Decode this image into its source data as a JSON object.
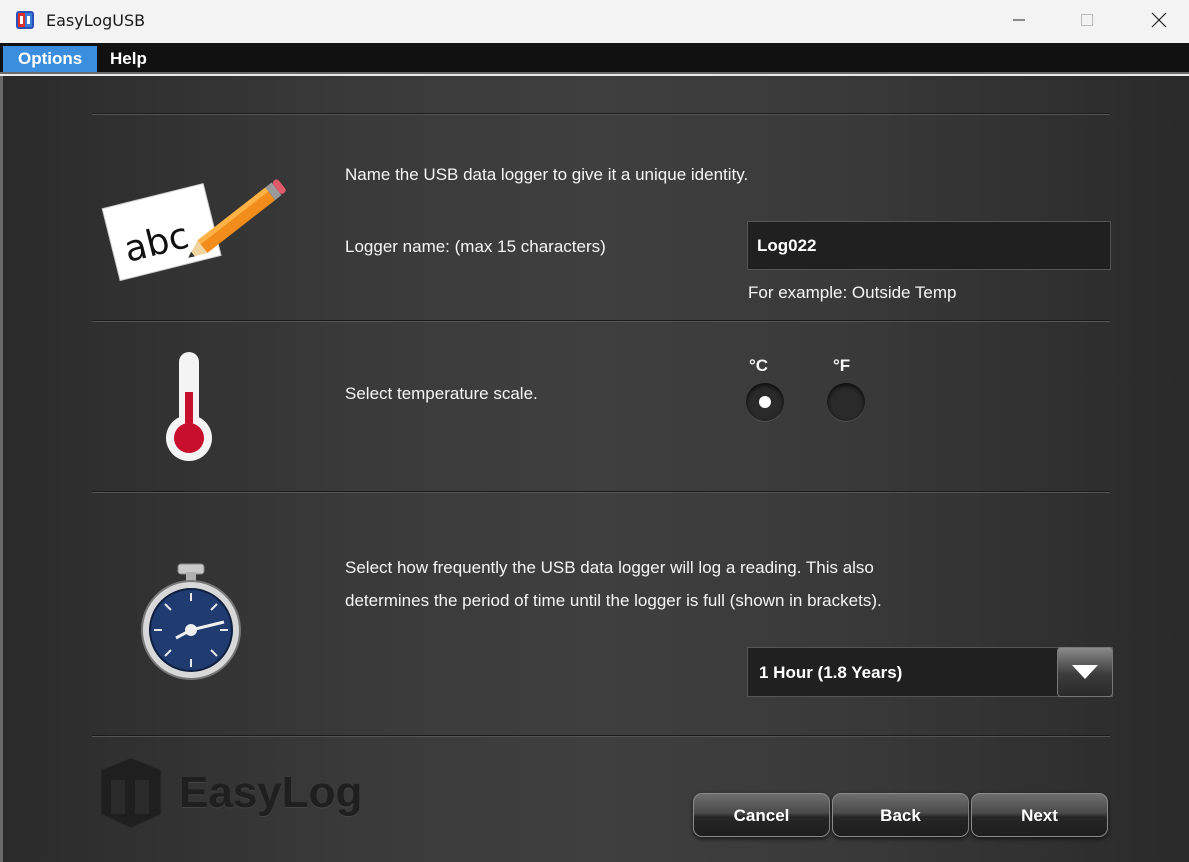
{
  "window": {
    "title": "EasyLogUSB"
  },
  "menu": {
    "items": [
      "Options",
      "Help"
    ]
  },
  "name_section": {
    "instruction": "Name the USB data logger to give it a unique identity.",
    "label": "Logger name: (max 15 characters)",
    "value": "Log022",
    "example": "For example: Outside Temp"
  },
  "temperature_section": {
    "instruction": "Select temperature scale.",
    "options": [
      "°C",
      "°F"
    ],
    "selected": "°C"
  },
  "rate_section": {
    "instruction_line1": "Select how frequently the USB data logger will log a reading. This also",
    "instruction_line2": "determines the period of time until the logger is full (shown in brackets).",
    "selected": "1 Hour (1.8 Years)"
  },
  "buttons": {
    "cancel": "Cancel",
    "back": "Back",
    "next": "Next"
  },
  "brand": {
    "logo_text": "EasyLog"
  },
  "colors": {
    "menu_highlight": "#3b8ede",
    "panel": "#3a3a3a",
    "thermometer_red": "#c8102e"
  }
}
